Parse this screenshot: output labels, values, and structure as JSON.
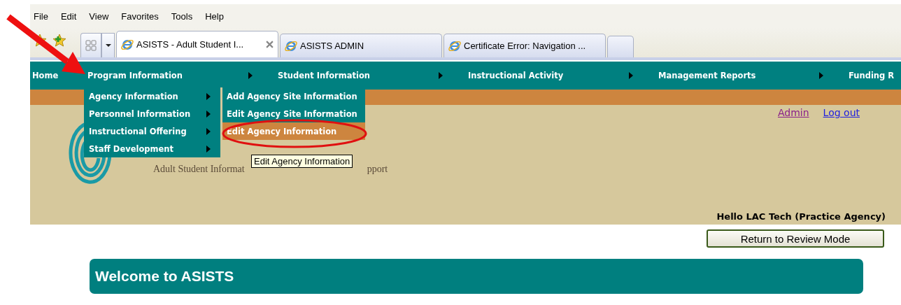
{
  "menu_bar": [
    "File",
    "Edit",
    "View",
    "Favorites",
    "Tools",
    "Help"
  ],
  "tabs": [
    {
      "title": "ASISTS - Adult Student I...",
      "selected": true,
      "closable": true
    },
    {
      "title": "ASISTS ADMIN",
      "selected": false,
      "closable": false
    },
    {
      "title": "Certificate Error: Navigation ...",
      "selected": false,
      "closable": false
    }
  ],
  "nav": [
    {
      "label": "Home",
      "has_submenu": false
    },
    {
      "label": "Program Information",
      "has_submenu": true
    },
    {
      "label": "Student Information",
      "has_submenu": true
    },
    {
      "label": "Instructional Activity",
      "has_submenu": true
    },
    {
      "label": "Management Reports",
      "has_submenu": true
    },
    {
      "label": "Funding R",
      "has_submenu": false
    }
  ],
  "program_menu": [
    {
      "label": "Agency Information",
      "has_submenu": true
    },
    {
      "label": "Personnel Information",
      "has_submenu": true
    },
    {
      "label": "Instructional Offering",
      "has_submenu": true
    },
    {
      "label": "Staff Development",
      "has_submenu": true
    }
  ],
  "agency_menu": [
    {
      "label": "Add Agency Site Information",
      "selected": false
    },
    {
      "label": "Edit Agency Site Information",
      "selected": false
    },
    {
      "label": "Edit Agency Information",
      "selected": true
    }
  ],
  "tooltip": "Edit Agency Information",
  "logo_text": [
    "Adult Student Informat",
    "pport"
  ],
  "links": [
    {
      "label": "Admin",
      "visited": true
    },
    {
      "label": "Log out",
      "visited": false
    }
  ],
  "greeting": "Hello LAC Tech (Practice Agency)",
  "review_button": "Return to Review Mode",
  "welcome_title": "Welcome to ASISTS"
}
